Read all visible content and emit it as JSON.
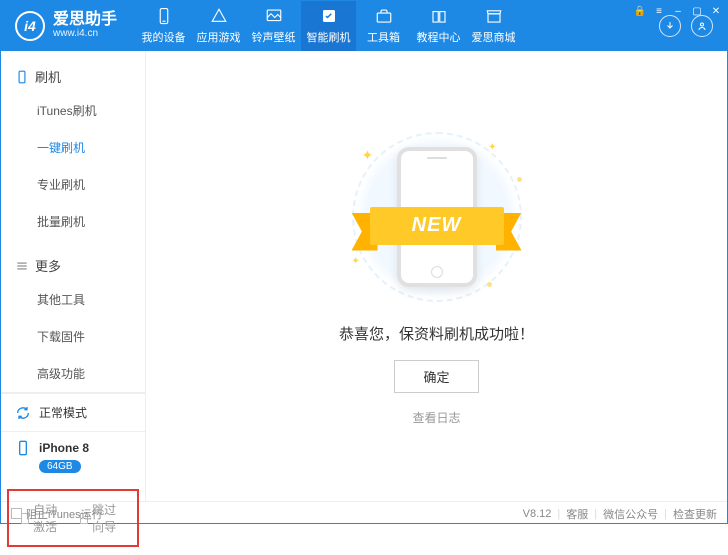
{
  "brand": {
    "logo": "i4",
    "name": "爱思助手",
    "url": "www.i4.cn"
  },
  "nav": {
    "items": [
      {
        "label": "我的设备"
      },
      {
        "label": "应用游戏"
      },
      {
        "label": "铃声壁纸"
      },
      {
        "label": "智能刷机"
      },
      {
        "label": "工具箱"
      },
      {
        "label": "教程中心"
      },
      {
        "label": "爱思商城"
      }
    ]
  },
  "sidebar": {
    "group1": {
      "head": "刷机",
      "items": [
        "iTunes刷机",
        "一键刷机",
        "专业刷机",
        "批量刷机"
      ]
    },
    "group2": {
      "head": "更多",
      "items": [
        "其他工具",
        "下载固件",
        "高级功能"
      ]
    },
    "status": "正常模式",
    "device": {
      "name": "iPhone 8",
      "storage": "64GB"
    }
  },
  "options": {
    "auto_activate": "自动激活",
    "skip_wizard": "跳过向导"
  },
  "main": {
    "ribbon": "NEW",
    "success": "恭喜您，保资料刷机成功啦！",
    "ok": "确定",
    "log": "查看日志"
  },
  "footer": {
    "block_itunes": "阻止iTunes运行",
    "version": "V8.12",
    "service": "客服",
    "wechat": "微信公众号",
    "update": "检查更新"
  }
}
